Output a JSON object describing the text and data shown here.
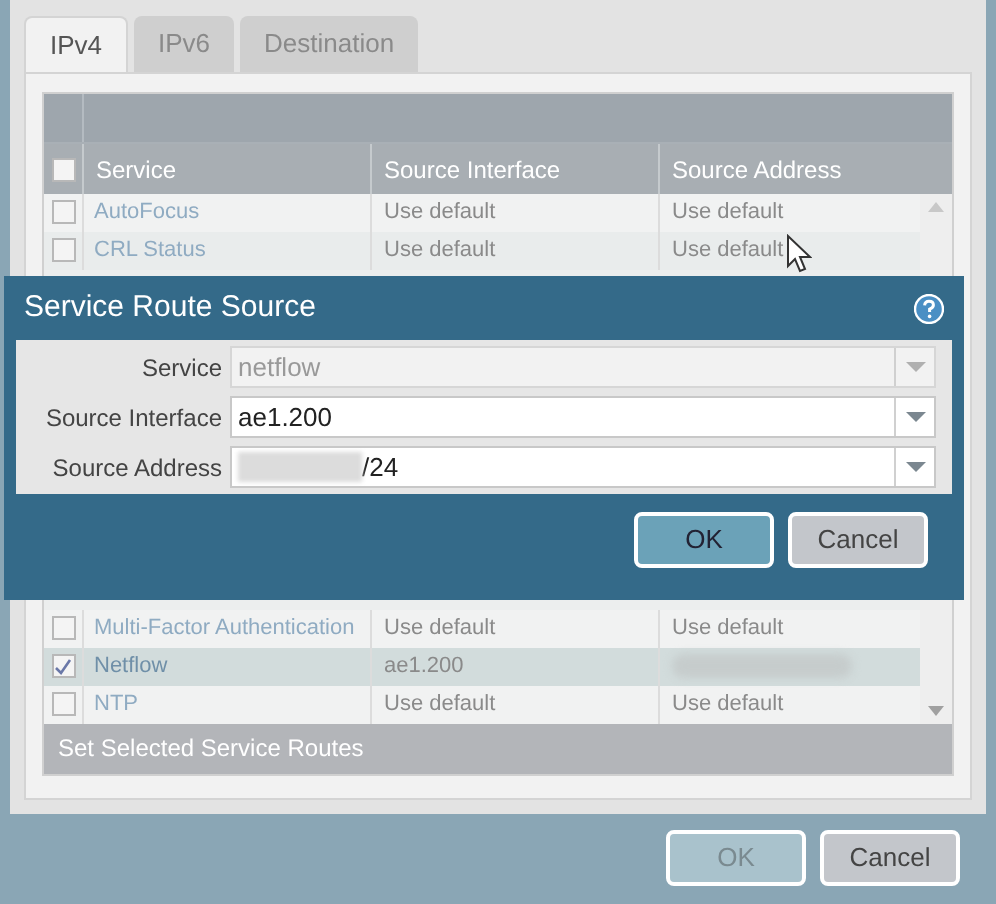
{
  "tabs": [
    {
      "label": "IPv4",
      "selected": true
    },
    {
      "label": "IPv6",
      "selected": false
    },
    {
      "label": "Destination",
      "selected": false
    }
  ],
  "table": {
    "header_checkbox": {
      "checked": false
    },
    "columns": [
      "Service",
      "Source Interface",
      "Source Address"
    ],
    "rows_above_dialog": [
      {
        "service": "AutoFocus",
        "source_interface": "Use default",
        "source_address": "Use default",
        "checked": false,
        "selected": false,
        "address_redacted": false
      },
      {
        "service": "CRL Status",
        "source_interface": "Use default",
        "source_address": "Use default",
        "checked": false,
        "selected": false,
        "address_redacted": false
      }
    ],
    "rows_below_dialog": [
      {
        "service": "Multi-Factor Authentication",
        "source_interface": "Use default",
        "source_address": "Use default",
        "checked": false,
        "selected": false,
        "address_redacted": false
      },
      {
        "service": "Netflow",
        "source_interface": "ae1.200",
        "checked": true,
        "selected": true,
        "address_redacted": true
      },
      {
        "service": "NTP",
        "source_interface": "Use default",
        "source_address": "Use default",
        "checked": false,
        "selected": false,
        "address_redacted": false
      }
    ],
    "footer_button": "Set Selected Service Routes"
  },
  "dialog": {
    "title": "Service Route Source",
    "fields": [
      {
        "label": "Service",
        "value": "netflow",
        "disabled": true,
        "redacted": false
      },
      {
        "label": "Source Interface",
        "value": "ae1.200",
        "disabled": false,
        "redacted": false
      },
      {
        "label": "Source Address",
        "value": "/24",
        "disabled": false,
        "redacted": true
      }
    ],
    "buttons": [
      {
        "label": "OK",
        "kind": "primary"
      },
      {
        "label": "Cancel",
        "kind": "secondary"
      }
    ]
  },
  "buttons": [
    {
      "label": "OK",
      "kind": "primary",
      "disabled": true
    },
    {
      "label": "Cancel",
      "kind": "secondary",
      "disabled": false
    }
  ]
}
